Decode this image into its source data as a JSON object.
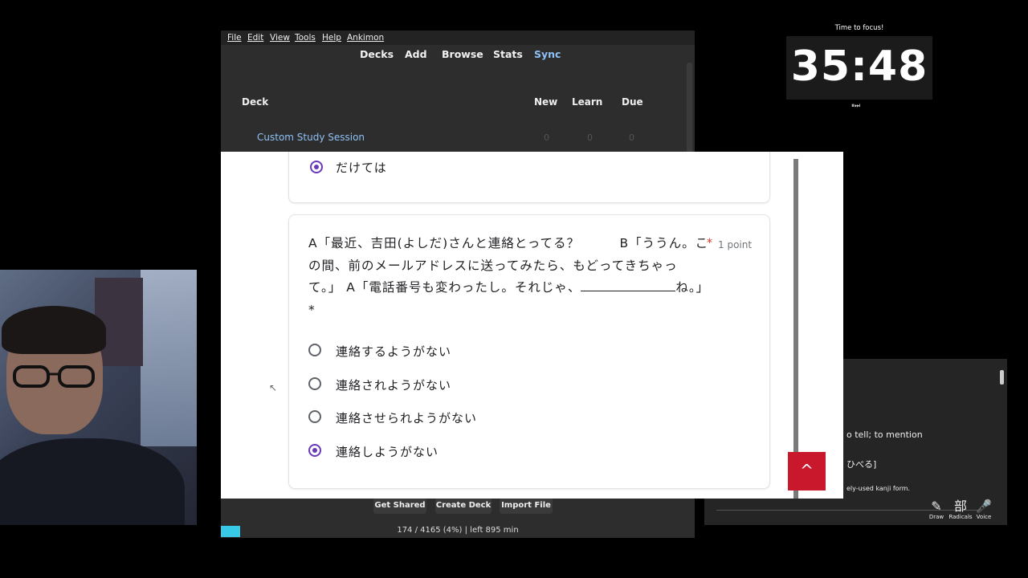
{
  "anki": {
    "menu": [
      "File",
      "Edit",
      "View",
      "Tools",
      "Help",
      "Ankimon"
    ],
    "toolbar": [
      "Decks",
      "Add",
      "Browse",
      "Stats",
      "Sync"
    ],
    "table": {
      "deck": "Deck",
      "new": "New",
      "learn": "Learn",
      "due": "Due"
    },
    "decks": [
      {
        "name": "Custom Study Session",
        "new": "0",
        "learn": "0",
        "due": "0"
      }
    ],
    "buttons": [
      "Get Shared",
      "Create Deck",
      "Import File"
    ],
    "status": "174 / 4165 (4%) | left 895 min"
  },
  "timer": {
    "label": "Time to focus!",
    "time": "35:48",
    "controls": "⏸⏭"
  },
  "dictionary": {
    "lines": [
      "o tell; to mention",
      "ひべる]",
      "ely-used kanji form."
    ],
    "tools": [
      {
        "icon": "✎",
        "label": "Draw"
      },
      {
        "icon": "部",
        "label": "Radicals"
      },
      {
        "icon": "🎤",
        "label": "Voice"
      }
    ]
  },
  "form": {
    "prev_answer": "だけては",
    "question_part1": "A「最近、吉田(よしだ)さんと連絡とってる？　　　B「ううん。この間、前のメールアドレスに送ってみたら、もどってきちゃって。」 A「電話番号も変わったし。それじゃ、",
    "question_part2": "ね。」*",
    "required_mark": "*",
    "points": "1 point",
    "options": [
      {
        "label": "連絡するようがない",
        "checked": false
      },
      {
        "label": "連絡されようがない",
        "checked": false
      },
      {
        "label": "連絡させられようがない",
        "checked": false
      },
      {
        "label": "連絡しようがない",
        "checked": true
      }
    ],
    "back_to_top": "^"
  }
}
